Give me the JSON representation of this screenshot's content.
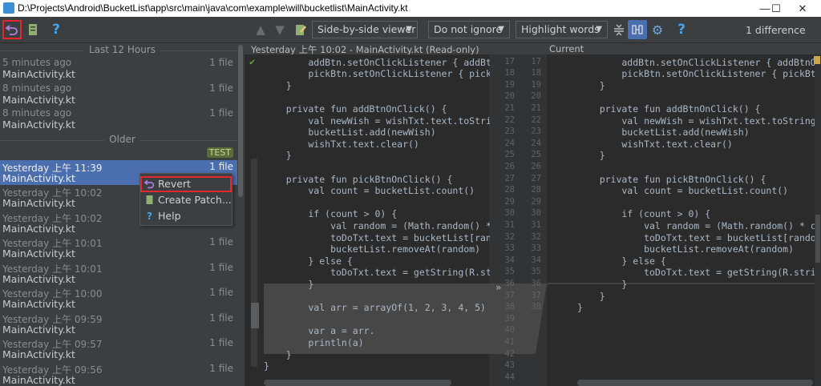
{
  "window": {
    "title": "D:\\Projects\\Android\\BucketList\\app\\src\\main\\java\\com\\example\\will\\bucketlist\\MainActivity.kt",
    "minimize": "—",
    "maximize": "☐",
    "close": "✕"
  },
  "toolbar": {
    "viewer": "Side-by-side viewer",
    "ignore": "Do not ignore",
    "highlight": "Highlight words",
    "difference_count": "1 difference"
  },
  "history": {
    "section_recent": "Last 12 Hours",
    "section_older": "Older",
    "recent_items": [
      {
        "date": "5 minutes ago",
        "count": "1 file",
        "file": "MainActivity.kt"
      },
      {
        "date": "8 minutes ago",
        "count": "1 file",
        "file": "MainActivity.kt"
      },
      {
        "date": "8 minutes ago",
        "count": "1 file",
        "file": "MainActivity.kt"
      }
    ],
    "tag": "TEST",
    "older_items": [
      {
        "date": "Yesterday 上午 11:39",
        "count": "1 file",
        "file": "MainActivity.kt"
      },
      {
        "date": "Yesterday 上午 10:02",
        "count": "1 file",
        "file": "MainActivity.kt"
      },
      {
        "date": "Yesterday 上午 10:02",
        "count": "1 file",
        "file": "MainActivity.kt"
      },
      {
        "date": "Yesterday 上午 10:01",
        "count": "1 file",
        "file": "MainActivity.kt"
      },
      {
        "date": "Yesterday 上午 10:01",
        "count": "1 file",
        "file": "MainActivity.kt"
      },
      {
        "date": "Yesterday 上午 10:00",
        "count": "1 file",
        "file": "MainActivity.kt"
      },
      {
        "date": "Yesterday 上午 09:59",
        "count": "1 file",
        "file": "MainActivity.kt"
      },
      {
        "date": "Yesterday 上午 09:57",
        "count": "1 file",
        "file": "MainActivity.kt"
      },
      {
        "date": "Yesterday 上午 09:56",
        "count": "1 file",
        "file": "MainActivity.kt"
      }
    ]
  },
  "context_menu": {
    "revert": "Revert",
    "create_patch": "Create Patch...",
    "help": "Help"
  },
  "diff": {
    "left_title": "Yesterday 上午 10:02 - MainActivity.kt (Read-only)",
    "right_title": "Current",
    "left_numbers": [
      "17",
      "18",
      "19",
      "20",
      "21",
      "22",
      "23",
      "24",
      "25",
      "26",
      "27",
      "28",
      "29",
      "30",
      "31",
      "32",
      "33",
      "34",
      "35",
      "36",
      "37",
      "38",
      "39",
      "40",
      "41",
      "42",
      "43",
      "44"
    ],
    "right_numbers": [
      "17",
      "18",
      "19",
      "20",
      "21",
      "22",
      "23",
      "24",
      "25",
      "26",
      "27",
      "28",
      "29",
      "30",
      "31",
      "32",
      "33",
      "34",
      "35",
      "36",
      "37",
      "38"
    ],
    "left_lines": [
      "        addBtn.setOnClickListener { addBtnOnC",
      "        pickBtn.setOnClickListener { pickBtnO",
      "    }",
      "",
      "    private fun addBtnOnClick() {",
      "        val newWish = wishTxt.text.toString()",
      "        bucketList.add(newWish)",
      "        wishTxt.text.clear()",
      "    }",
      "",
      "    private fun pickBtnOnClick() {",
      "        val count = bucketList.count()",
      "",
      "        if (count > 0) {",
      "            val random = (Math.random() * cou",
      "            toDoTxt.text = bucketList[random]",
      "            bucketList.removeAt(random)",
      "        } else {",
      "            toDoTxt.text = getString(R.st",
      "        }",
      "",
      "        val arr = arrayOf(1, 2, 3, 4, 5)",
      "",
      "        var a = arr.",
      "        println(a)",
      "    }",
      "}",
      ""
    ],
    "right_lines": [
      "        addBtn.setOnClickListener { addBtnOnClic",
      "        pickBtn.setOnClickListener { pickBtnOnCl",
      "    }",
      "",
      "    private fun addBtnOnClick() {",
      "        val newWish = wishTxt.text.toString()",
      "        bucketList.add(newWish)",
      "        wishTxt.text.clear()",
      "    }",
      "",
      "    private fun pickBtnOnClick() {",
      "        val count = bucketList.count()",
      "",
      "        if (count > 0) {",
      "            val random = (Math.random() * count)",
      "            toDoTxt.text = bucketList[random]",
      "            bucketList.removeAt(random)",
      "        } else {",
      "            toDoTxt.text = getString(R.strin",
      "        }",
      "    }",
      "}"
    ]
  }
}
